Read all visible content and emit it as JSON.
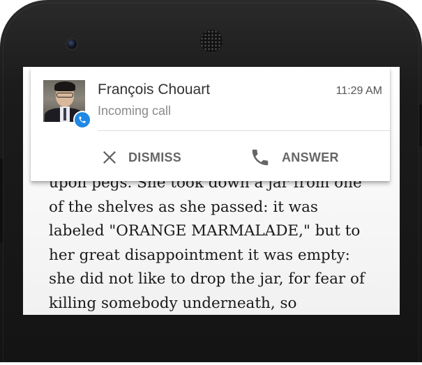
{
  "notification": {
    "caller_name": "François Chouart",
    "time": "11:29 AM",
    "subtitle": "Incoming call",
    "avatar_icon": "person-photo",
    "badge_icon": "phone-icon",
    "badge_color": "#1e88e5",
    "actions": [
      {
        "label": "DISMISS",
        "icon": "close-icon"
      },
      {
        "label": "ANSWER",
        "icon": "phone-icon"
      }
    ]
  },
  "reading": {
    "lines": [
      "upon pegs. She took down a jar from one",
      "of the shelves as she passed: it was",
      "labeled \"ORANGE MARMALADE,\" but to",
      "her great disappointment it was empty:",
      "she did not like to drop the jar, for fear of",
      "killing somebody underneath, so"
    ]
  }
}
